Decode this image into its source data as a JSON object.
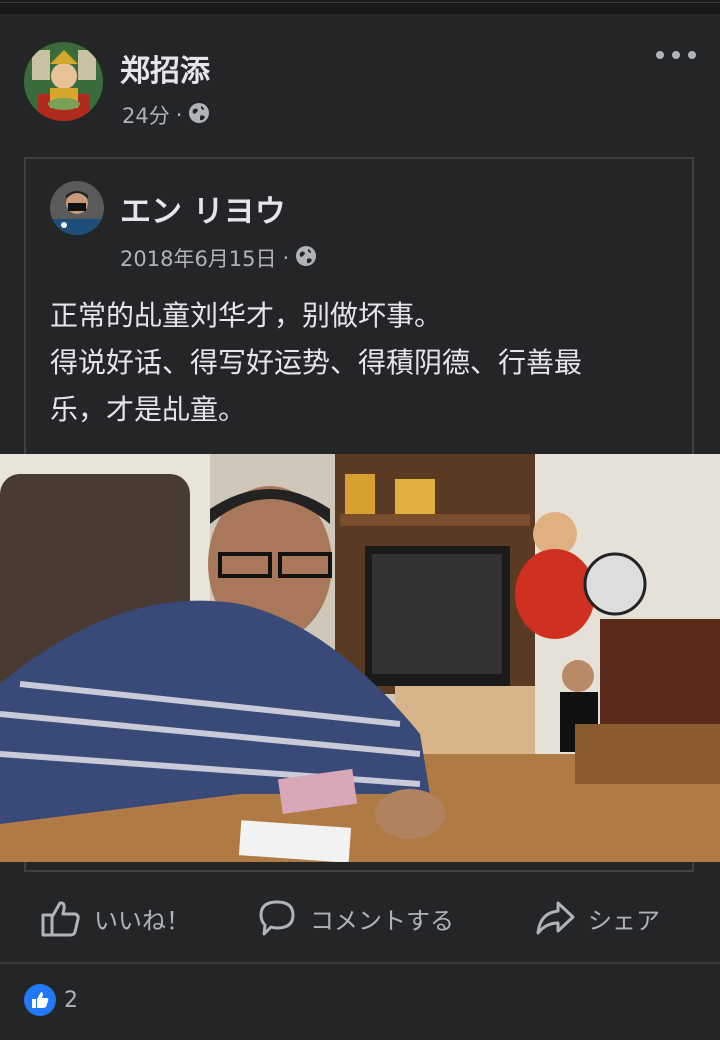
{
  "post": {
    "author": "郑招添",
    "time": "24分",
    "separator": "·",
    "audience_icon": "globe-icon",
    "more_icon": "more-dots-icon"
  },
  "shared_post": {
    "author": "エン リヨウ",
    "date": "2018年6月15日",
    "separator": "·",
    "audience_icon": "globe-icon",
    "text_lines": [
      "正常的乩童刘华才，别做坏事。",
      "得说好话、得写好运势、得積阴德、行善最",
      "乐，才是乩童。"
    ]
  },
  "actions": {
    "like": "いいね！",
    "comment": "コメントする",
    "share": "シェア"
  },
  "reactions": {
    "count": "2",
    "icon": "like-thumb-icon"
  },
  "colors": {
    "background": "#18191a",
    "card": "#242526",
    "text_primary": "#e4e6eb",
    "text_secondary": "#b0b3b8",
    "like_blue": "#2078f4"
  }
}
